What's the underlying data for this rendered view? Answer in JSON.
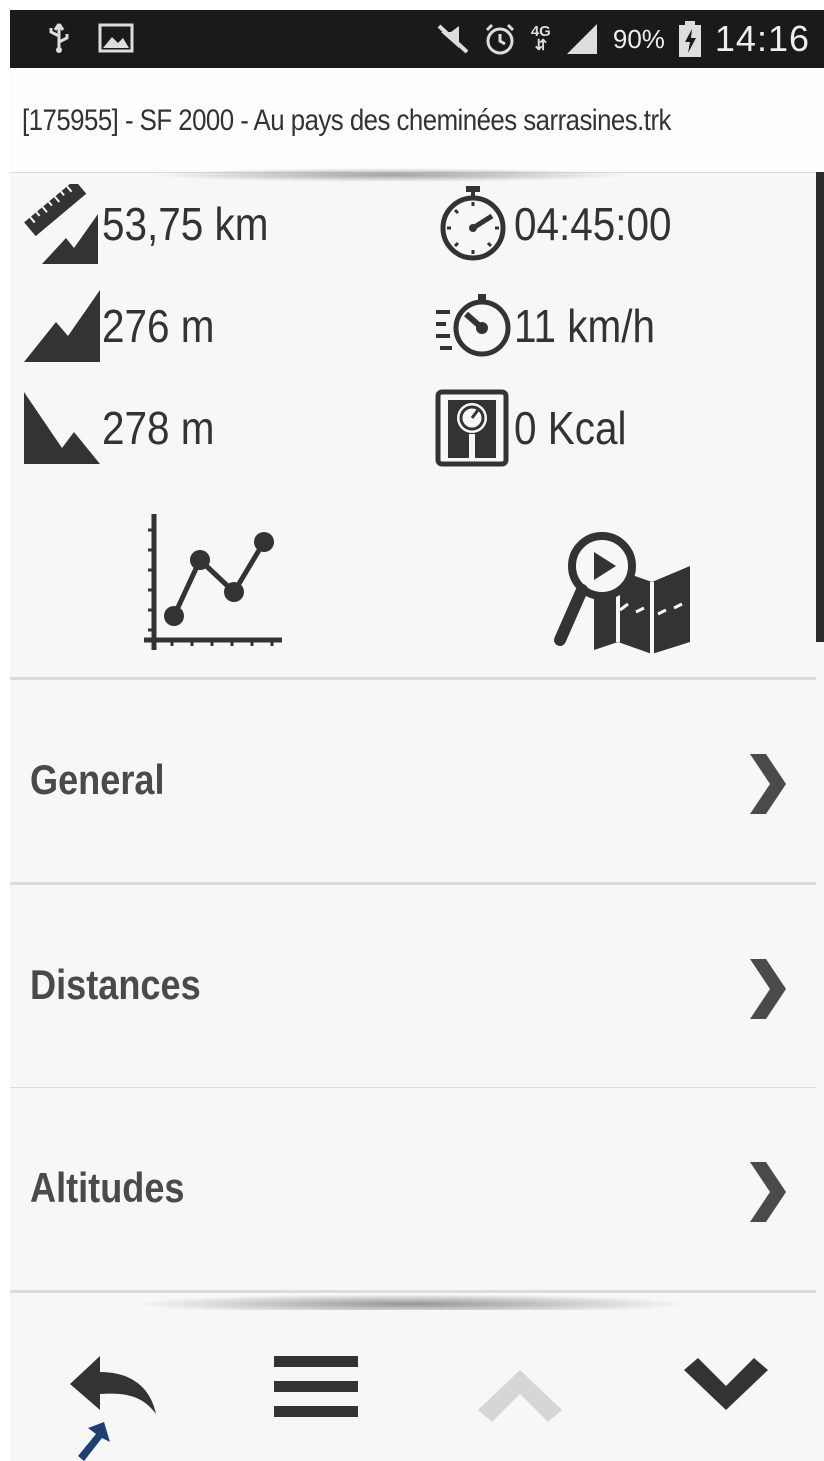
{
  "status_bar": {
    "battery": "90%",
    "time": "14:16",
    "network": "4G",
    "icons": [
      "usb-icon",
      "image-icon",
      "mute-icon",
      "alarm-icon",
      "network-4g-icon",
      "signal-icon",
      "battery-charging-icon"
    ]
  },
  "title": "[175955] - SF 2000 - Au pays des cheminées sarrasines.trk",
  "stats": {
    "distance": "53,75 km",
    "duration": "04:45:00",
    "elevation_gain": "276 m",
    "avg_speed": "11 km/h",
    "elevation_loss": "278 m",
    "calories": "0 Kcal"
  },
  "actions": {
    "chart_icon": "line-chart-icon",
    "map_icon": "map-search-icon"
  },
  "menu": {
    "items": [
      {
        "label": "General"
      },
      {
        "label": "Distances"
      },
      {
        "label": "Altitudes"
      }
    ]
  },
  "toolbar": {
    "icons": [
      "back-icon",
      "hamburger-menu-icon",
      "chevron-up-icon",
      "chevron-down-icon"
    ]
  },
  "colors": {
    "status_bg": "#1a1a1a",
    "background": "#f7f7f7",
    "text": "#333333",
    "icon": "#333333",
    "disabled": "#d6d6d6",
    "pointer": "#1f3f6e"
  }
}
